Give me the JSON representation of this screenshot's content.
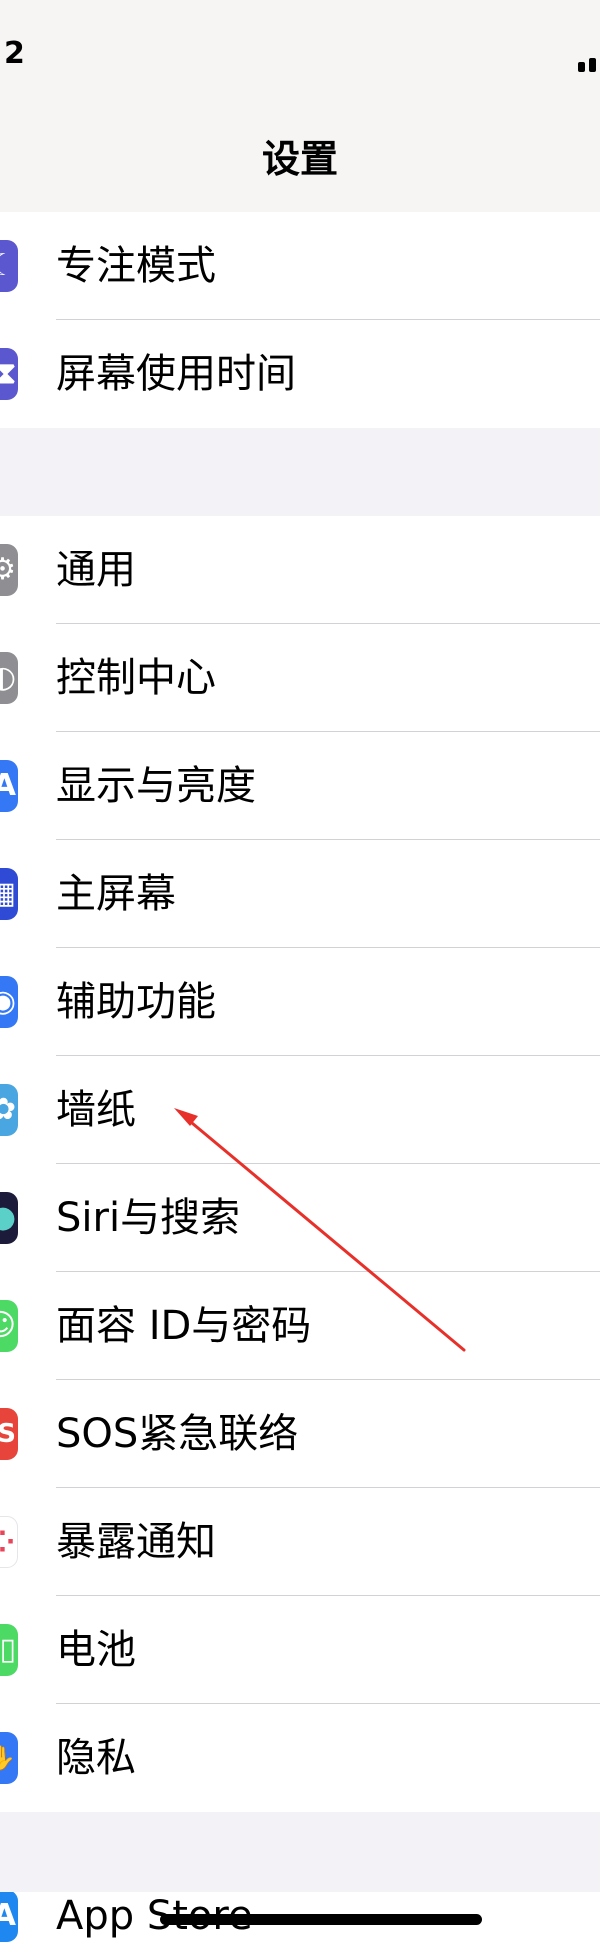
{
  "status_bar": {
    "time": "2"
  },
  "nav": {
    "title": "设置"
  },
  "group1": {
    "items": [
      {
        "label": "专注模式",
        "icon": "moon-icon",
        "color": "#5b57cf",
        "glyph": "☾"
      },
      {
        "label": "屏幕使用时间",
        "icon": "hourglass-icon",
        "color": "#5b57cf",
        "glyph": "⧗"
      }
    ]
  },
  "group2": {
    "items": [
      {
        "label": "通用",
        "icon": "gear-icon",
        "color": "#8e8e93",
        "glyph": "⚙"
      },
      {
        "label": "控制中心",
        "icon": "toggles-icon",
        "color": "#8e8e93",
        "glyph": "◐"
      },
      {
        "label": "显示与亮度",
        "icon": "text-size-icon",
        "color": "#3478f6",
        "glyph": "A"
      },
      {
        "label": "主屏幕",
        "icon": "home-screen-icon",
        "color": "#2f4bd6",
        "glyph": "▦"
      },
      {
        "label": "辅助功能",
        "icon": "accessibility-icon",
        "color": "#3478f6",
        "glyph": "◉"
      },
      {
        "label": "墙纸",
        "icon": "flower-icon",
        "color": "#4aa6e0",
        "glyph": "✿"
      },
      {
        "label": "Siri与搜索",
        "icon": "siri-icon",
        "color": "#1c1c3a",
        "glyph": "●"
      },
      {
        "label": "面容 ID与密码",
        "icon": "face-id-icon",
        "color": "#4cd964",
        "glyph": "☺"
      },
      {
        "label": "SOS紧急联络",
        "icon": "sos-icon",
        "color": "#e7443b",
        "glyph": "S"
      },
      {
        "label": "暴露通知",
        "icon": "exposure-icon",
        "color": "#ffffff",
        "glyph": "⁘"
      },
      {
        "label": "电池",
        "icon": "battery-icon",
        "color": "#4cd964",
        "glyph": "▯"
      },
      {
        "label": "隐私",
        "icon": "hand-icon",
        "color": "#3478f6",
        "glyph": "✋"
      }
    ]
  },
  "group3": {
    "items": [
      {
        "label": "App Store",
        "icon": "app-store-icon",
        "color": "#1e88f0",
        "glyph": "A"
      }
    ]
  },
  "annotation": {
    "color": "#e8302a"
  }
}
